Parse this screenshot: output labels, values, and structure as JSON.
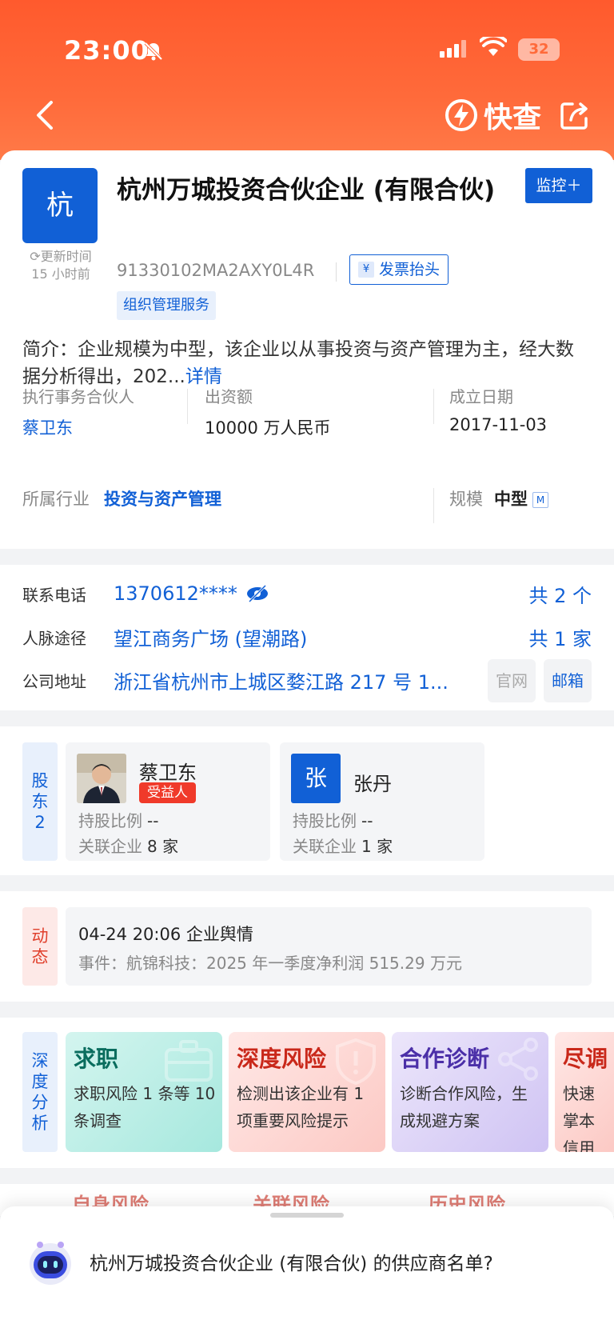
{
  "status": {
    "time": "23:00",
    "battery": "32"
  },
  "nav": {
    "brand": "快查"
  },
  "company": {
    "logo_char": "杭",
    "update_label": "更新时间",
    "update_time": "15 小时前",
    "name": "杭州万城投资合伙企业 (有限合伙)",
    "monitor": "监控＋",
    "credit_code": "91330102MA2AXY0L4R",
    "invoice": "发票抬头",
    "tag": "组织管理服务",
    "intro": "简介：企业规模为中型，该企业以从事投资与资产管理为主，经大数据分析得出，202...",
    "intro_more": "详情",
    "partner_label": "执行事务合伙人",
    "partner": "蔡卫东",
    "capital_label": "出资额",
    "capital": "10000 万人民币",
    "founded_label": "成立日期",
    "founded": "2017-11-03",
    "industry_label": "所属行业",
    "industry": "投资与资产管理",
    "scale_label": "规模",
    "scale": "中型",
    "scale_badge": "M"
  },
  "contact": {
    "phone_label": "联系电话",
    "phone": "1370612****",
    "phone_count": "共 2 个",
    "network_label": "人脉途径",
    "network": "望江商务广场 (望潮路)",
    "network_count": "共 1 家",
    "addr_label": "公司地址",
    "addr": "浙江省杭州市上城区婺江路 217 号 1...",
    "site_btn": "官网",
    "mail_btn": "邮箱"
  },
  "shareholders": {
    "label_line1": "股",
    "label_line2": "东",
    "count": "2",
    "items": [
      {
        "name": "蔡卫东",
        "badge": "受益人",
        "ratio_label": "持股比例",
        "ratio": "--",
        "rel_label": "关联企业",
        "rel": "8 家"
      },
      {
        "avatar_char": "张",
        "name": "张丹",
        "ratio_label": "持股比例",
        "ratio": "--",
        "rel_label": "关联企业",
        "rel": "1 家"
      }
    ]
  },
  "news": {
    "label_line1": "动",
    "label_line2": "态",
    "title": "04-24 20:06 企业舆情",
    "detail": "事件：航锦科技：2025 年一季度净利润 515.29 万元"
  },
  "analysis": {
    "label": [
      "深",
      "度",
      "分",
      "析"
    ],
    "tiles": [
      {
        "title": "求职",
        "desc": "求职风险 1 条等 10 条调查"
      },
      {
        "title": "深度风险",
        "desc": "检测出该企业有 1 项重要风险提示"
      },
      {
        "title": "合作诊断",
        "desc": "诊断合作风险，生成规避方案"
      },
      {
        "title": "尽调",
        "desc": "快速掌本信用"
      }
    ]
  },
  "peek": [
    "自身风险",
    "关联风险",
    "历史风险"
  ],
  "assistant": {
    "question": "杭州万城投资合伙企业 (有限合伙) 的供应商名单?"
  },
  "colors": {
    "brand": "#ff5a2d",
    "primary": "#1160d6",
    "danger": "#f03a2a"
  }
}
